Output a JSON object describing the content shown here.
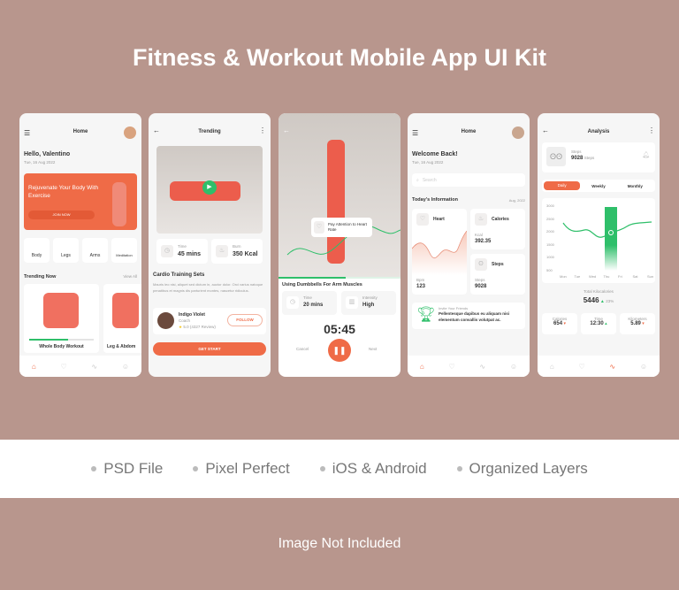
{
  "title": "Fitness & Workout Mobile App UI Kit",
  "features": [
    "PSD File",
    "Pixel Perfect",
    "iOS & Android",
    "Organized Layers"
  ],
  "footer": "Image Not Included",
  "colors": {
    "accent": "#ef6b47",
    "green": "#2fbf6a",
    "background": "#b8968d"
  },
  "screen1": {
    "header": "Home",
    "greeting": "Hello, Valentino",
    "date": "Tue, 16 Aug 2022",
    "banner_title": "Rejuvenate Your Body With Exercise",
    "banner_button": "JOIN NOW",
    "categories": [
      "Body",
      "Legs",
      "Arms",
      "Meditation"
    ],
    "section": "Trending Now",
    "view_all": "View All",
    "cards": [
      "Whole Body Workout",
      "Leg & Abdom"
    ],
    "progress": 0.6
  },
  "screen2": {
    "header": "Trending",
    "time_label": "Time",
    "time_value": "45 mins",
    "burn_label": "Burn",
    "burn_value": "350 Kcal",
    "section": "Cardio Training Sets",
    "description": "Mauris leo nisi, aliquet sed dictum in, auctor dolor. Orci varius natoque penatibus et magnis dis parturient montes, nascetur ridiculus.",
    "coach_name": "Indigo Violet",
    "coach_role": "Coach",
    "rating": "5.0 (4327 Review)",
    "follow": "FOLLOW",
    "button": "GET START"
  },
  "screen3": {
    "tooltip": "Pay Attention to Heart Rate",
    "title": "Using Dumbbells For Arm Muscles",
    "time_label": "Time",
    "time_value": "20 mins",
    "intensity_label": "Intensity",
    "intensity_value": "High",
    "timer": "05:45",
    "cancel": "Cancel",
    "next": "Next",
    "progress": 0.55
  },
  "screen4": {
    "header": "Home",
    "greeting": "Welcome Back!",
    "date": "Tue, 16 Aug 2022",
    "search_placeholder": "Search",
    "section": "Today's Information",
    "month": "Aug, 2022",
    "heart_label": "Heart",
    "heart_unit": "Bpm",
    "heart_value": "123",
    "calories_label": "Calories",
    "calories_unit": "Kcal",
    "calories_value": "392.35",
    "steps_label": "Steps",
    "steps_unit": "Steps",
    "steps_value": "9028",
    "invite_label": "Invite Your Friends",
    "invite_text": "Pellentesque dapibus eu aliquam nisi elementum convallis volutpat ac."
  },
  "screen5": {
    "header": "Analysis",
    "steps_label": "Steps",
    "steps_value": "9028",
    "steps_unit": "Steps",
    "tabs": [
      "Daily",
      "Weekly",
      "Monthly"
    ],
    "yticks": [
      "3000",
      "2500",
      "2000",
      "1500",
      "1000",
      "500"
    ],
    "days": [
      "Mon",
      "Tue",
      "Wed",
      "Thu",
      "Fri",
      "Sat",
      "Sun"
    ],
    "total_label": "Total Kilocalories",
    "total_value": "5446",
    "total_change": "23%",
    "stats": [
      {
        "label": "Calories",
        "value": "654"
      },
      {
        "label": "Time",
        "value": "12:30"
      },
      {
        "label": "Kilometers",
        "value": "5.89"
      }
    ]
  }
}
